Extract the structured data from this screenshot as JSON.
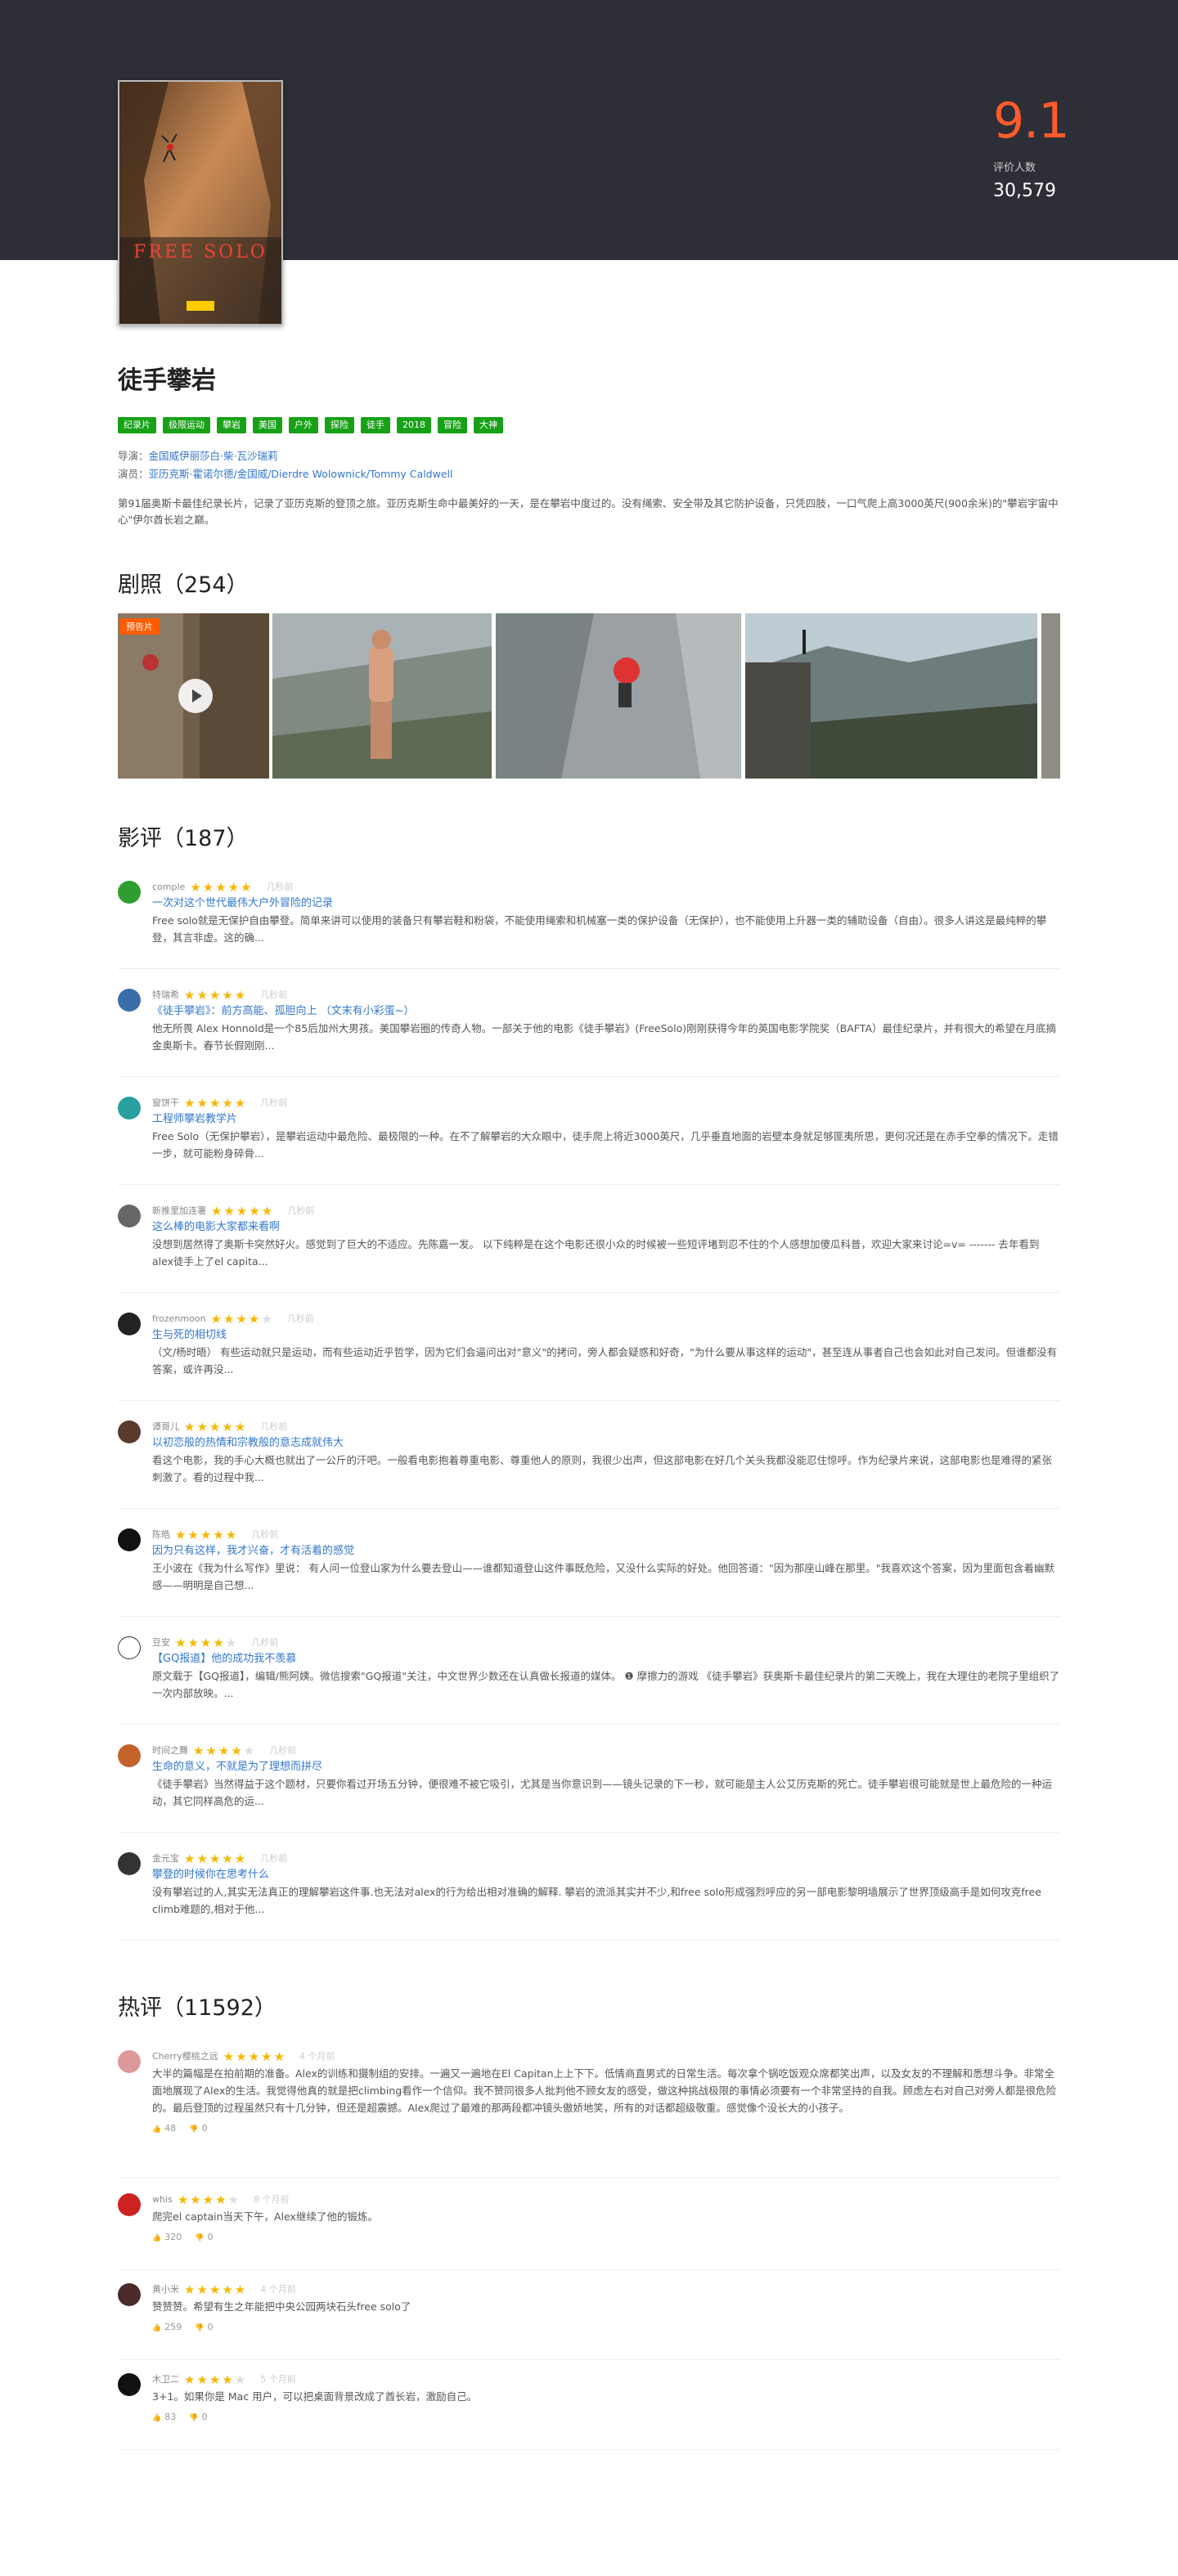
{
  "movie": {
    "poster_alt": "Free Solo poster",
    "poster_title": "FREE SOLO",
    "score": "9.1",
    "score_label": "评价人数",
    "score_count": "30,579",
    "title": "徒手攀岩",
    "tags": [
      "纪录片",
      "极限运动",
      "攀岩",
      "美国",
      "户外",
      "探险",
      "徒手",
      "2018",
      "冒险",
      "大神"
    ],
    "director_label": "导演：",
    "director": "金国威伊丽莎白·柴·瓦沙瑞莉",
    "cast_label": "演员：",
    "cast": "亚历克斯·霍诺尔德/金国威/Dierdre Wolownick/Tommy Caldwell",
    "summary": "第91届奥斯卡最佳纪录长片，记录了亚历克斯的登顶之旅。亚历克斯生命中最美好的一天，是在攀岩中度过的。没有绳索、安全带及其它防护设备，只凭四肢，一口气爬上高3000英尺(900余米)的\"攀岩宇宙中心\"伊尔酋长岩之巅。"
  },
  "stills": {
    "heading": "剧照（254）",
    "trailer_label": "预告片"
  },
  "reviews": {
    "heading": "影评（187）",
    "items": [
      {
        "user": "comple",
        "time": "几秒前",
        "stars": 5,
        "title": "一次对这个世代最伟大户外冒险的记录",
        "text": "Free solo就是无保护自由攀登。简单来讲可以使用的装备只有攀岩鞋和粉袋，不能使用绳索和机械塞一类的保护设备（无保护），也不能使用上升器一类的辅助设备（自由）。很多人讲这是最纯粹的攀登，其言非虚。这的确..."
      },
      {
        "user": "特瑞希",
        "time": "几秒前",
        "stars": 5,
        "title": "《徒手攀岩》：前方高能、孤胆向上 （文末有小彩蛋~）",
        "text": "他无所畏 Alex Honnold是一个85后加州大男孩。美国攀岩圈的传奇人物。一部关于他的电影《徒手攀岩》(FreeSolo)刚刚获得今年的英国电影学院奖（BAFTA）最佳纪录片，并有很大的希望在月底摘金奥斯卡。春节长假刚刚..."
      },
      {
        "user": "窗饼干",
        "time": "几秒前",
        "stars": 5,
        "title": "工程师攀岩教学片",
        "text": "Free Solo（无保护攀岩），是攀岩运动中最危险、最极限的一种。在不了解攀岩的大众眼中，徒手爬上将近3000英尺，几乎垂直地面的岩壁本身就足够匪夷所思，更何况还是在赤手空拳的情况下。走错一步，就可能粉身碎骨..."
      },
      {
        "user": "新推里加连署",
        "time": "几秒前",
        "stars": 5,
        "title": "这么棒的电影大家都来看啊",
        "text": "没想到居然得了奥斯卡突然好火。感觉到了巨大的不适应。先陈嘉一发。 以下纯粹是在这个电影还很小众的时候被一些短评堵到忍不住的个人感想加傻瓜科普，欢迎大家来讨论=v= ------- 去年看到alex徒手上了el capita..."
      },
      {
        "user": "frozenmoon",
        "time": "几秒前",
        "stars": 4,
        "title": "生与死的相切线",
        "text": "（文/杨时晤） 有些运动就只是运动，而有些运动近乎哲学，因为它们会逼问出对\"意义\"的拷问，旁人都会疑惑和好奇，\"为什么要从事这样的运动\"，甚至连从事者自己也会如此对自己发问。但谁都没有答案，或许再没..."
      },
      {
        "user": "谭哥儿",
        "time": "几秒前",
        "stars": 5,
        "title": "以初恋般的热情和宗教般的意志成就伟大",
        "text": "看这个电影，我的手心大概也就出了一公斤的汗吧。一般看电影抱着尊重电影、尊重他人的原则，我很少出声，但这部电影在好几个关头我都没能忍住惊呼。作为纪录片来说，这部电影也是难得的紧张刺激了。看的过程中我..."
      },
      {
        "user": "陈皓",
        "time": "几秒前",
        "stars": 5,
        "title": "因为只有这样，我才兴奋，才有活着的感觉",
        "text": "王小波在《我为什么写作》里说： 有人问一位登山家为什么要去登山——谁都知道登山这件事既危险，又没什么实际的好处。他回答道：\"因为那座山峰在那里。\"我喜欢这个答案，因为里面包含着幽默感——明明是自己想..."
      },
      {
        "user": "豆安",
        "time": "几秒前",
        "stars": 4,
        "title": "【GQ报道】他的成功我不羡慕",
        "text": "原文载于【GQ报道】，编辑/熊阿姨。微信搜索\"GQ报道\"关注，中文世界少数还在认真做长报道的媒体。 ❶ 摩擦力的游戏 《徒手攀岩》获奥斯卡最佳纪录片的第二天晚上，我在大理住的老院子里组织了一次内部放映。..."
      },
      {
        "user": "时间之舞",
        "time": "几秒前",
        "stars": 4,
        "title": "生命的意义，不就是为了理想而拼尽",
        "text": "《徒手攀岩》当然得益于这个题材，只要你看过开场五分钟，便很难不被它吸引，尤其是当你意识到——镜头记录的下一秒，就可能是主人公艾历克斯的死亡。徒手攀岩很可能就是世上最危险的一种运动，其它同样高危的运..."
      },
      {
        "user": "金元宝",
        "time": "几秒前",
        "stars": 5,
        "title": "攀登的时候你在思考什么",
        "text": "没有攀岩过的人,其实无法真正的理解攀岩这件事.也无法对alex的行为给出相对准确的解释. 攀岩的流派其实并不少,和free solo形成强烈呼应的另一部电影黎明墙展示了世界顶级高手是如何攻克free climb难题的,相对于他..."
      }
    ]
  },
  "comments": {
    "heading": "热评（11592）",
    "items": [
      {
        "user": "Cherry樱桃之远",
        "time": "4 个月前",
        "stars": 5,
        "text": "大半的篇幅是在拍前期的准备。Alex的训练和摄制组的安排。一遍又一遍地在El Capitan上上下下。低情商直男式的日常生活。每次拿个锅吃饭观众席都笑出声，以及女友的不理解和悉想斗争。非常全面地展现了Alex的生活。我觉得他真的就是把climbing看作一个信仰。我不赞同很多人批判他不顾女友的感受，做这种挑战极限的事情必须要有一个非常坚持的自我。顾虑左右对自己对旁人都是很危险的。最后登顶的过程虽然只有十几分钟，但还是超震撼。Alex爬过了最难的那两段都冲镜头傲娇地笑，所有的对话都超级敬重。感觉像个没长大的小孩子。",
        "up": "48",
        "down": "0"
      },
      {
        "user": "whis",
        "time": "8 个月前",
        "stars": 4,
        "text": "爬完el captain当天下午，Alex继续了他的锻炼。",
        "up": "320",
        "down": "0"
      },
      {
        "user": "黄小米",
        "time": "4 个月前",
        "stars": 5,
        "text": "赞赞赞。希望有生之年能把中央公园两块石头free solo了",
        "up": "259",
        "down": "0"
      },
      {
        "user": "木卫二",
        "time": "5 个月前",
        "stars": 4,
        "text": "3+1。如果你是 Mac 用户，可以把桌面背景改成了酋长岩，激励自己。",
        "up": "83",
        "down": "0"
      }
    ]
  },
  "colors": {
    "hero_bg": "#2e2e37",
    "score": "#ff5c2b",
    "tag_bg": "#17a117",
    "link": "#3377cc",
    "star": "#f5b800"
  }
}
